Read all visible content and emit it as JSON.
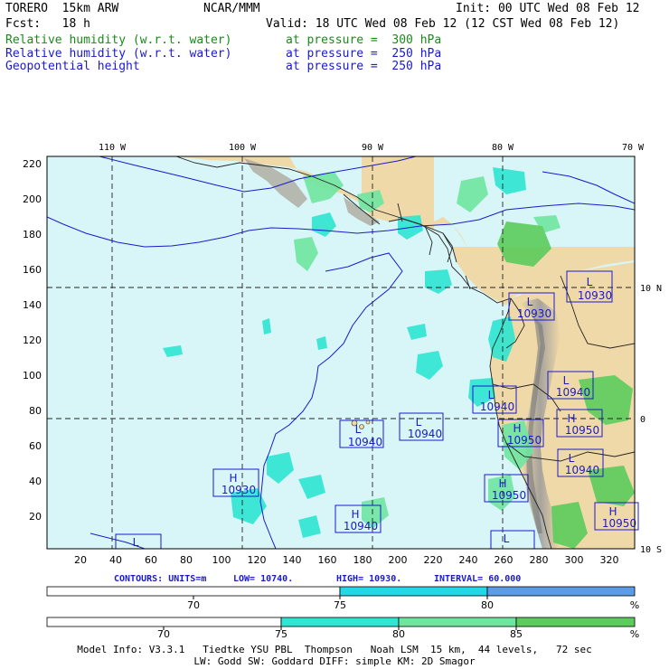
{
  "header": {
    "model": "TORERO  15km ARW",
    "org": "NCAR/MMM",
    "init": "Init: 00 UTC Wed 08 Feb 12",
    "fcst": "Fcst:   18 h",
    "valid": "Valid: 18 UTC Wed 08 Feb 12 (12 CST Wed 08 Feb 12)",
    "fields": [
      {
        "name": "Relative humidity (w.r.t. water)",
        "level": "at pressure =  300 hPa",
        "color": "#1a8a1a"
      },
      {
        "name": "Relative humidity (w.r.t. water)",
        "level": "at pressure =  250 hPa",
        "color": "#1a1acc"
      },
      {
        "name": "Geopotential height",
        "level": "at pressure =  250 hPa",
        "color": "#1a1acc"
      }
    ]
  },
  "map": {
    "top_lon_labels": [
      "110 W",
      "100 W",
      "90 W",
      "80 W",
      "70 W"
    ],
    "right_lat_labels": [
      "10 N",
      "0",
      "10 S"
    ],
    "left_ticks": [
      "220",
      "200",
      "180",
      "160",
      "140",
      "120",
      "100",
      "80",
      "60",
      "40",
      "20"
    ],
    "bottom_ticks": [
      "20",
      "40",
      "60",
      "80",
      "100",
      "120",
      "140",
      "160",
      "180",
      "200",
      "220",
      "240",
      "260",
      "280",
      "300",
      "320"
    ],
    "ocean_color": "#d8f6f8",
    "land_color": "#f0d9a8",
    "highs_lows": [
      {
        "type": "L",
        "value": "10930"
      },
      {
        "type": "L",
        "value": "10930"
      },
      {
        "type": "L",
        "value": "10940"
      },
      {
        "type": "L",
        "value": "10940"
      },
      {
        "type": "L",
        "value": "10940"
      },
      {
        "type": "L",
        "value": "10940"
      },
      {
        "type": "H",
        "value": "10950"
      },
      {
        "type": "H",
        "value": "10950"
      },
      {
        "type": "H",
        "value": "10950"
      },
      {
        "type": "L",
        "value": "10940"
      },
      {
        "type": "H",
        "value": "10930"
      },
      {
        "type": "H",
        "value": "10940"
      },
      {
        "type": "H",
        "value": "10950"
      },
      {
        "type": "L",
        "value": ""
      }
    ]
  },
  "contours": {
    "units": "CONTOURS: UNITS=m",
    "low": "LOW= 10740.",
    "high": "HIGH= 10930.",
    "interval": "INTERVAL= 60.000"
  },
  "colorbar1": {
    "labels": [
      "70",
      "75",
      "80",
      "%"
    ],
    "colors": [
      "#ffffff",
      "#22d7e6",
      "#5b9be8"
    ]
  },
  "colorbar2": {
    "labels": [
      "70",
      "75",
      "80",
      "85",
      "%"
    ],
    "colors": [
      "#ffffff",
      "#2ee6d2",
      "#6ee6a0",
      "#5ccc5c"
    ]
  },
  "footer": {
    "line1": "Model Info: V3.3.1   Tiedtke YSU PBL  Thompson   Noah LSM  15 km,  44 levels,   72 sec",
    "line2": "LW: Godd SW: Goddard DIFF: simple KM: 2D Smagor"
  }
}
